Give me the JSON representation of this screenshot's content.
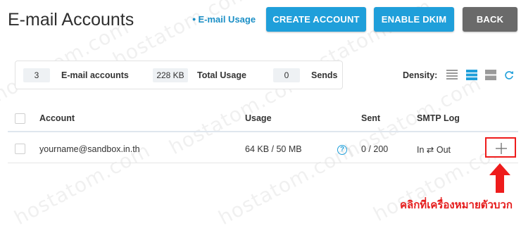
{
  "header": {
    "title": "E-mail Accounts",
    "usage_link": "E-mail Usage",
    "buttons": {
      "create": "CREATE ACCOUNT",
      "dkim": "ENABLE DKIM",
      "back": "BACK"
    }
  },
  "stats": {
    "accounts_count": "3",
    "accounts_label": "E-mail accounts",
    "usage_value": "228 KB",
    "usage_label": "Total Usage",
    "sends_value": "0",
    "sends_label": "Sends"
  },
  "density": {
    "label": "Density:",
    "options": [
      "density-compact",
      "density-normal",
      "density-comfortable"
    ],
    "active": "density-normal"
  },
  "table": {
    "columns": [
      "Account",
      "Usage",
      "Sent",
      "SMTP Log"
    ],
    "rows": [
      {
        "account": "yourname@sandbox.in.th",
        "usage": "64 KB / 50 MB",
        "sent": "0 / 200",
        "smtp_log": "In ⇄ Out"
      }
    ]
  },
  "annotation": {
    "text": "คลิกที่เครื่องหมายตัวบวก"
  },
  "watermark": "hostatom.com",
  "colors": {
    "primary": "#1f9fda",
    "back_button": "#6a6a6a",
    "annotation_red": "#e51c1c"
  }
}
